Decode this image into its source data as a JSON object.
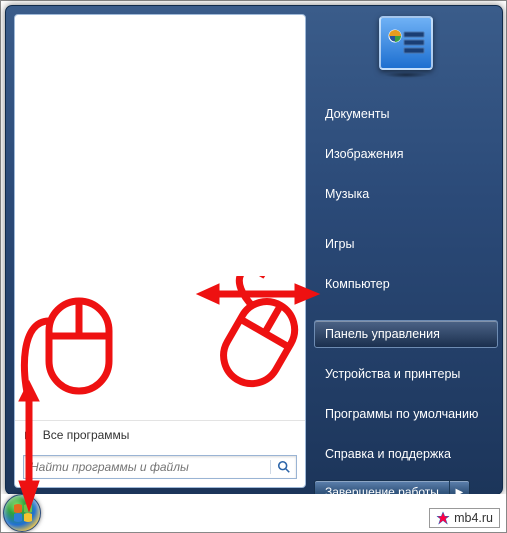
{
  "right_links": [
    {
      "label": "Документы",
      "selected": false
    },
    {
      "label": "Изображения",
      "selected": false
    },
    {
      "label": "Музыка",
      "selected": false
    },
    {
      "label": "Игры",
      "selected": false
    },
    {
      "label": "Компьютер",
      "selected": false
    },
    {
      "label": "Панель управления",
      "selected": true
    },
    {
      "label": "Устройства и принтеры",
      "selected": false
    },
    {
      "label": "Программы по умолчанию",
      "selected": false
    },
    {
      "label": "Справка и поддержка",
      "selected": false
    }
  ],
  "all_programs_label": "Все программы",
  "search": {
    "placeholder": "Найти программы и файлы"
  },
  "shutdown": {
    "label": "Завершение работы"
  },
  "watermark": {
    "text": "mb4.ru"
  }
}
